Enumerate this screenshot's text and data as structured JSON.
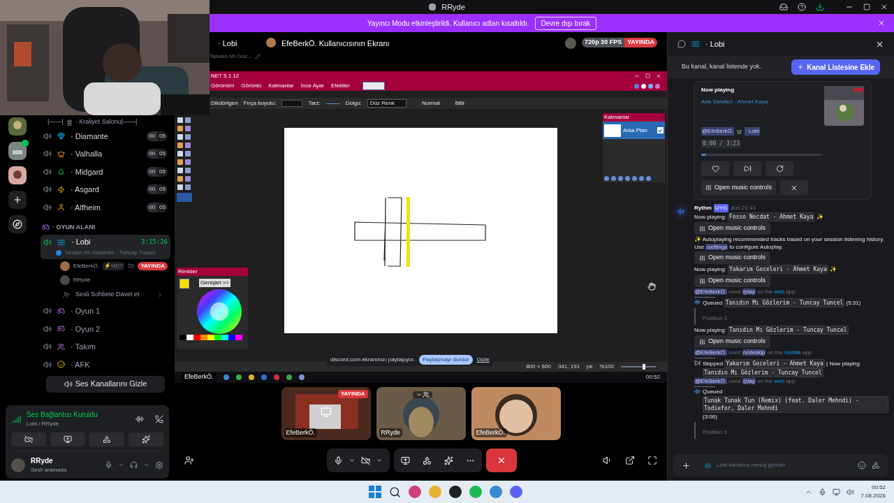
{
  "title_bar": {
    "title": "RRyde"
  },
  "banner": {
    "text": "Yayıncı Modu etkinleştirildi. Kullanıcı adları kısaltıldı.",
    "button": "Devre dışı bırak"
  },
  "channel_list": {
    "header_prefix": "|——|",
    "header": "· Kraliyet Salonu|——|",
    "limited": [
      {
        "name": "· Diamante",
        "count": "00",
        "limit": "05"
      },
      {
        "name": "· Valhalla",
        "count": "00",
        "limit": "05"
      },
      {
        "name": "· Midgard",
        "count": "00",
        "limit": "05"
      },
      {
        "name": "· Asgard",
        "count": "00",
        "limit": "05"
      },
      {
        "name": "· Alfheim",
        "count": "00",
        "limit": "05"
      }
    ],
    "category": "· OYUN ALANI",
    "active": {
      "name": "· Lobi",
      "timer": "3:15:26",
      "activity": "Tanıdın Mı Gözlerim - Tuncay Tuncel",
      "selected": true
    },
    "members": [
      {
        "name": "EfeBerkÖ.",
        "tag": "⚡MDT",
        "live": "YAYINDA"
      },
      {
        "name": "RRyde"
      }
    ],
    "invite": "Sesli Sohbete Davet et",
    "others": [
      {
        "name": "· Oyun 1"
      },
      {
        "name": "· Oyun 2"
      },
      {
        "name": "· Takım"
      },
      {
        "name": "· AFK"
      }
    ],
    "hide_button": "Ses Kanallarını Gizle"
  },
  "voice_panel": {
    "status": "Ses Bağlantısı Kuruldu",
    "location": "Lobi / RRyde"
  },
  "user_panel": {
    "name": "RRyde",
    "status": "Sesli aramada"
  },
  "stage_header": {
    "channel": "· Lobi",
    "title": "EfeBerkÖ. Kullanıcısının Ekranı",
    "subtitle": "Tanıdın Mı Göz...",
    "quality": "720p 30 FPS",
    "live": "YAYINDA"
  },
  "shared_screen": {
    "app_title": "NET 5.1.12",
    "menus": [
      "Görünüm",
      "Görüntü",
      "Katmanlar",
      "İnce Ayar",
      "Efektler"
    ],
    "toolbar": {
      "shape": "Dikdörtgen",
      "brush": "Fırça boyutu:",
      "style": "Tarz:",
      "fill": "Dolgu:",
      "fill_value": "Düz Renk",
      "blend": "Normal",
      "finish": "Bitir"
    },
    "layers": {
      "title": "Katmanlar",
      "layer": "Arka Plan",
      "checked": true
    },
    "colors": {
      "title": "Renkler",
      "expand": "Genişlet >>"
    },
    "share_bar": {
      "text": "discord.com ekranınızı paylaşıyor.",
      "stop": "Paylaşmayı durdur",
      "hide": "Gizle"
    },
    "status": {
      "size": "800 × 600",
      "cursor": "341, 191",
      "unit": "pk",
      "zoom": "%100",
      "zoom_slider": {
        "level": 0.65
      }
    },
    "clock": "00:52",
    "stream_label": "EfeBerkÖ."
  },
  "tiles": [
    {
      "kind": "screen",
      "name": "EfeBerkÖ.",
      "live": "YAYINDA"
    },
    {
      "kind": "camera",
      "name": "RRyde"
    },
    {
      "kind": "avatar",
      "name": "EfeBerkÖ."
    }
  ],
  "chat": {
    "channel": "· Lobi",
    "notice": "Bu kanal, kanal listende yok.",
    "add_button": "Kanal Listesine Ekle",
    "now_playing": {
      "heading": "Now playing",
      "track": "Ada Sahilleri - Ahmet Kaya",
      "mention": "@EfeBerkÖ.",
      "channel": "· Lobi",
      "time": "0:00 / 3:23",
      "level": 0.04,
      "button": "Open music controls"
    },
    "author": "Rythm",
    "author_badge": "UYG",
    "timestamp": "dün 21:43",
    "blocks": [
      {
        "kind": "line",
        "parts": [
          {
            "kind": "text",
            "text": "Now playing:"
          },
          {
            "kind": "code",
            "text": "Fosso Necdat - Ahmet Kaya"
          },
          {
            "kind": "emoji",
            "text": "✨"
          }
        ]
      },
      {
        "kind": "button",
        "text": "Open music controls"
      },
      {
        "kind": "line",
        "parts": [
          {
            "kind": "emoji",
            "text": "✨"
          },
          {
            "kind": "text",
            "text": "Autoplaying recommended tracks based on your session listening history. Use"
          },
          {
            "kind": "command",
            "text": "/settings"
          },
          {
            "kind": "text",
            "text": "to configure Autoplay."
          }
        ]
      },
      {
        "kind": "button",
        "text": "Open music controls"
      },
      {
        "kind": "line",
        "parts": [
          {
            "kind": "text",
            "text": "Now playing:"
          },
          {
            "kind": "code",
            "text": "Yakarım Geceleri - Ahmet Kaya"
          },
          {
            "kind": "emoji",
            "text": "✨"
          }
        ]
      },
      {
        "kind": "button",
        "text": "Open music controls"
      },
      {
        "kind": "used",
        "parts": [
          {
            "kind": "mention",
            "text": "@EfeBerkÖ."
          },
          {
            "kind": "muted",
            "text": "used"
          },
          {
            "kind": "command",
            "text": "/play"
          },
          {
            "kind": "muted",
            "text": "on the"
          },
          {
            "kind": "link",
            "text": "web"
          },
          {
            "kind": "muted",
            "text": "app"
          }
        ]
      },
      {
        "kind": "queued",
        "parts": [
          {
            "kind": "text",
            "text": "Queued"
          },
          {
            "kind": "code",
            "text": "Tanıdın Mı Gözlerim - Tuncay Tuncel"
          },
          {
            "kind": "text",
            "text": "(5:31)"
          }
        ]
      },
      {
        "kind": "quote",
        "text": "Position 1"
      },
      {
        "kind": "line",
        "parts": [
          {
            "kind": "text",
            "text": "Now playing:"
          },
          {
            "kind": "code",
            "text": "Tanıdın Mı Gözlerim - Tuncay Tuncel"
          }
        ]
      },
      {
        "kind": "button",
        "text": "Open music controls"
      },
      {
        "kind": "used",
        "parts": [
          {
            "kind": "mention",
            "text": "@EfeBerkÖ."
          },
          {
            "kind": "muted",
            "text": "used"
          },
          {
            "kind": "command",
            "text": "/voteskip"
          },
          {
            "kind": "muted",
            "text": "on the"
          },
          {
            "kind": "link",
            "text": "mobile"
          },
          {
            "kind": "muted",
            "text": "app"
          }
        ]
      },
      {
        "kind": "skipped",
        "parts": [
          {
            "kind": "text",
            "text": "Skipped"
          },
          {
            "kind": "code",
            "text": "Yakarım Geceleri - Ahmet Kaya"
          },
          {
            "kind": "text",
            "text": "| Now playing"
          },
          {
            "kind": "code",
            "text": "Tanıdın Mı Gözlerim - Tuncay Tuncel"
          }
        ]
      },
      {
        "kind": "used",
        "parts": [
          {
            "kind": "mention",
            "text": "@EfeBerkÖ."
          },
          {
            "kind": "muted",
            "text": "used"
          },
          {
            "kind": "command",
            "text": "/play"
          },
          {
            "kind": "muted",
            "text": "on the"
          },
          {
            "kind": "link",
            "text": "web"
          },
          {
            "kind": "muted",
            "text": "app"
          }
        ]
      },
      {
        "kind": "queued",
        "parts": [
          {
            "kind": "text",
            "text": "Queued"
          },
          {
            "kind": "code",
            "text": "Tunak Tunak Tun (Remix) (feat. Daler Mehndi) - Todiefor, Daler Mehndi"
          },
          {
            "kind": "text",
            "text": "(3:06)"
          }
        ]
      },
      {
        "kind": "quote",
        "text": "Position 1"
      }
    ],
    "placeholder": "Lobi kanalına mesaj gönder"
  },
  "taskbar": {
    "time": "00:52",
    "date": "7.08.2026"
  }
}
